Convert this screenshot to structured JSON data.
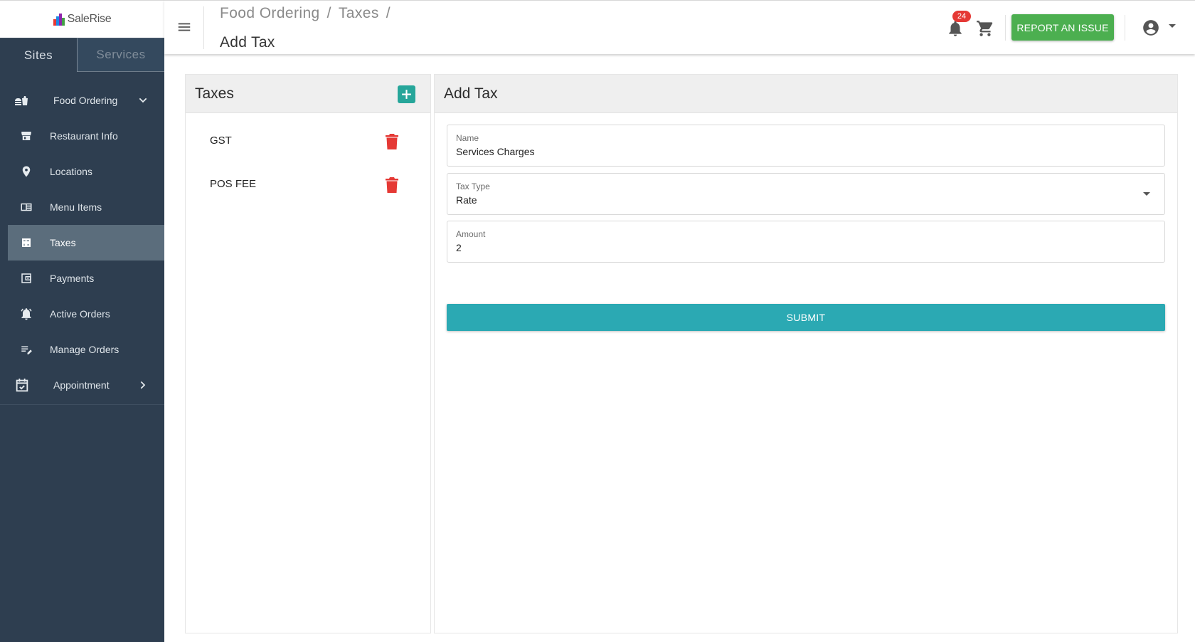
{
  "app": {
    "logo_text": "SaleRise"
  },
  "sidebar": {
    "tabs": [
      {
        "label": "Sites"
      },
      {
        "label": "Services"
      }
    ],
    "items": [
      {
        "label": "Food Ordering",
        "icon": "food-icon"
      },
      {
        "label": "Restaurant Info",
        "icon": "store-icon"
      },
      {
        "label": "Locations",
        "icon": "location-pin-icon"
      },
      {
        "label": "Menu Items",
        "icon": "menu-book-icon"
      },
      {
        "label": "Taxes",
        "icon": "calculator-icon"
      },
      {
        "label": "Payments",
        "icon": "wallet-icon"
      },
      {
        "label": "Active Orders",
        "icon": "bell-ring-icon"
      },
      {
        "label": "Manage Orders",
        "icon": "edit-list-icon"
      },
      {
        "label": "Appointment",
        "icon": "calendar-check-icon"
      }
    ]
  },
  "header": {
    "breadcrumb": [
      "Food Ordering",
      "Taxes"
    ],
    "separator": "/",
    "title": "Add Tax",
    "notification_count": "24",
    "report_button": "REPORT AN ISSUE"
  },
  "taxes_panel": {
    "title": "Taxes",
    "items": [
      {
        "name": "GST"
      },
      {
        "name": "POS FEE"
      }
    ]
  },
  "add_tax_panel": {
    "title": "Add Tax",
    "fields": {
      "name": {
        "label": "Name",
        "value": "Services Charges"
      },
      "tax_type": {
        "label": "Tax Type",
        "value": "Rate"
      },
      "amount": {
        "label": "Amount",
        "value": "2"
      }
    },
    "submit_label": "SUBMIT"
  },
  "colors": {
    "sidebar_bg": "#2e3e50",
    "active_item_bg": "#5b6d7c",
    "report_green": "#4caf50",
    "submit_teal": "#2ba9b3",
    "add_teal": "#26a69a",
    "delete_red": "#e53935"
  }
}
